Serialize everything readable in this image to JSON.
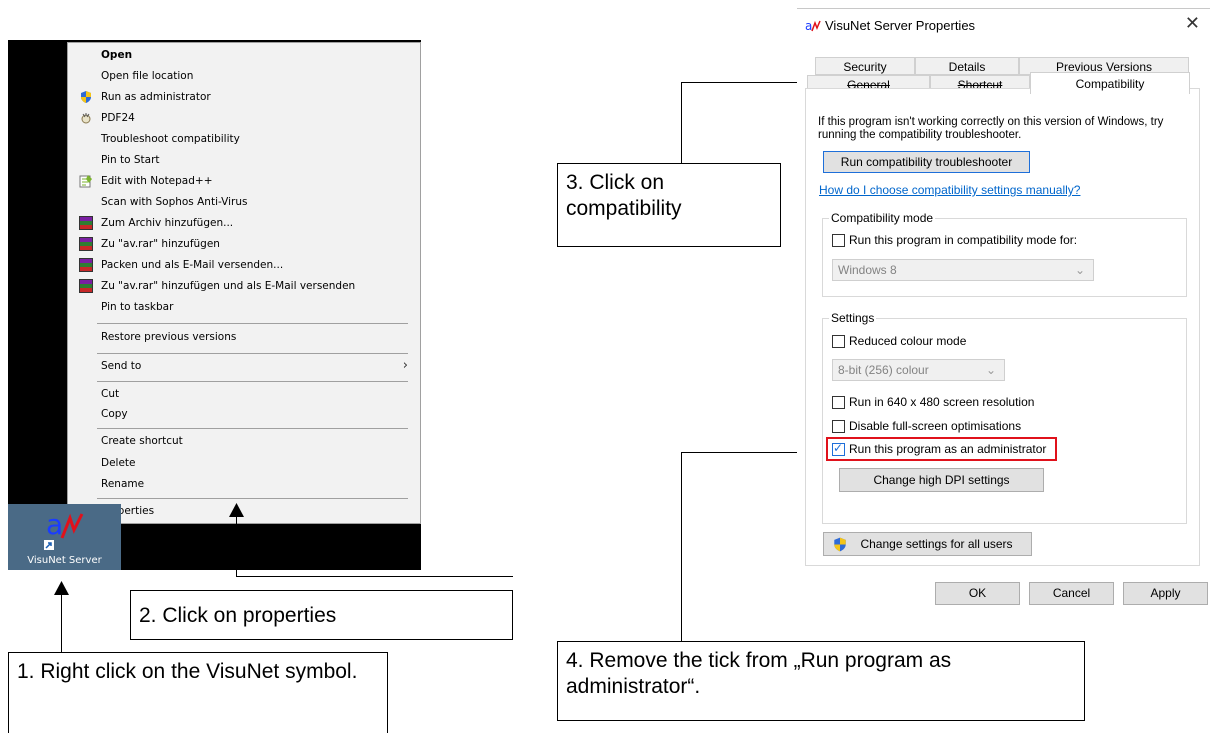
{
  "context_menu": {
    "items": [
      {
        "label": "Open",
        "bold": true
      },
      {
        "label": "Open file location"
      },
      {
        "label": "Run as administrator",
        "icon": "shield-icon"
      },
      {
        "label": "PDF24",
        "icon": "pdf24-icon"
      },
      {
        "label": "Troubleshoot compatibility"
      },
      {
        "label": "Pin to Start"
      },
      {
        "label": "Edit with Notepad++",
        "icon": "notepad-icon"
      },
      {
        "label": "Scan with Sophos Anti-Virus"
      },
      {
        "label": "Zum Archiv hinzufügen...",
        "icon": "winrar-icon"
      },
      {
        "label": "Zu \"av.rar\" hinzufügen",
        "icon": "winrar-icon"
      },
      {
        "label": "Packen und als E-Mail versenden...",
        "icon": "winrar-icon"
      },
      {
        "label": "Zu \"av.rar\" hinzufügen und als E-Mail versenden",
        "icon": "winrar-icon"
      },
      {
        "label": "Pin to taskbar"
      },
      {
        "label": "Restore previous versions"
      },
      {
        "label": "Send to",
        "submenu": true
      },
      {
        "label": "Cut"
      },
      {
        "label": "Copy"
      },
      {
        "label": "Create shortcut"
      },
      {
        "label": "Delete"
      },
      {
        "label": "Rename"
      },
      {
        "label": "Properties"
      }
    ]
  },
  "desktop_icon": {
    "label": "VisuNet Server"
  },
  "callouts": {
    "step1": "1. Right click on the VisuNet symbol.",
    "step2": "2. Click on properties",
    "step3": "3. Click on compatibility",
    "step4": "4. Remove the tick from „Run program as administrator“."
  },
  "dialog": {
    "title": "VisuNet Server Properties",
    "close": "✕",
    "tabs_row1": [
      "Security",
      "Details",
      "Previous Versions"
    ],
    "tabs_row2": [
      "General",
      "Shortcut",
      "Compatibility"
    ],
    "intro": "If this program isn't working correctly on this version of Windows, try running the compatibility troubleshooter.",
    "troubleshooter_button": "Run compatibility troubleshooter",
    "manual_link": "How do I choose compatibility settings manually?",
    "compat_mode": {
      "title": "Compatibility mode",
      "checkbox": "Run this program in compatibility mode for:",
      "checked": false,
      "select_value": "Windows 8"
    },
    "settings": {
      "title": "Settings",
      "reduced_colour": {
        "label": "Reduced colour mode",
        "checked": false
      },
      "colour_select": "8-bit (256) colour",
      "res640": {
        "label": "Run in 640 x 480 screen resolution",
        "checked": false
      },
      "disable_fullscreen": {
        "label": "Disable full-screen optimisations",
        "checked": false
      },
      "run_admin": {
        "label": "Run this program as an administrator",
        "checked": true
      },
      "dpi_button": "Change high DPI settings"
    },
    "all_users_button": "Change settings for all users",
    "ok": "OK",
    "cancel": "Cancel",
    "apply": "Apply"
  },
  "colors": {
    "highlight": "#e0111b",
    "link": "#0066cc",
    "accent": "#1e6fd9"
  }
}
